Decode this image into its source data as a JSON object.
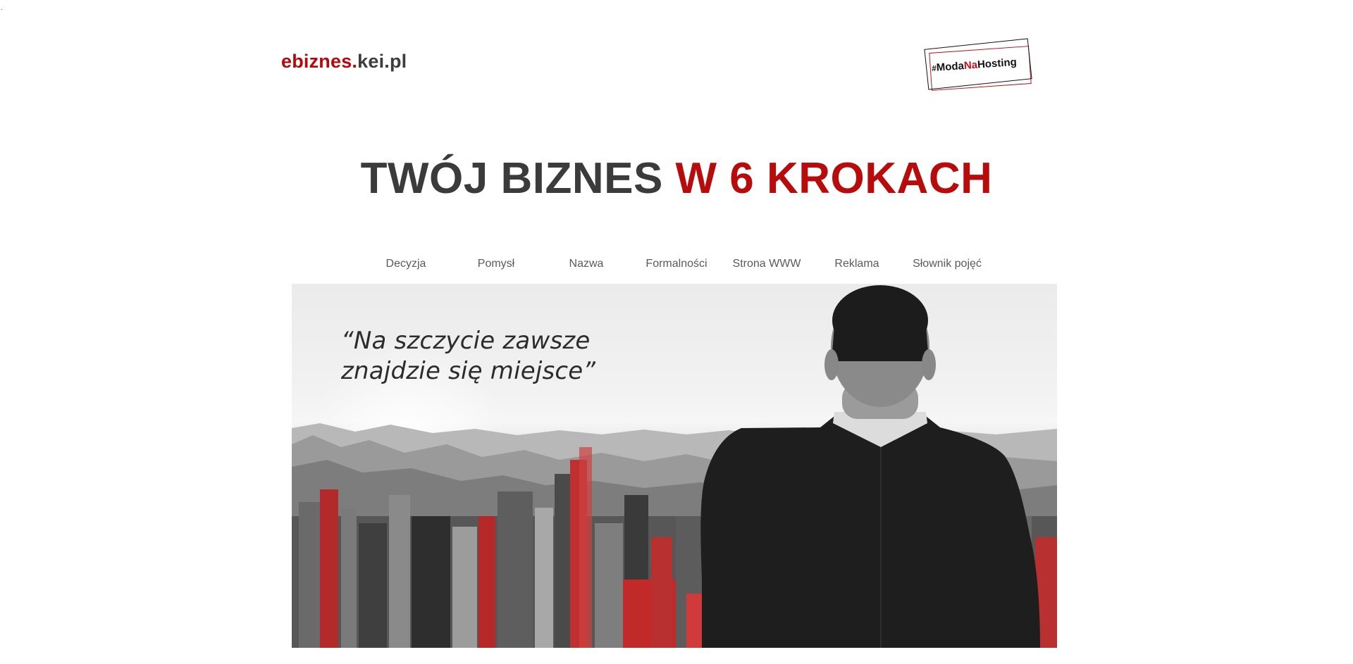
{
  "header": {
    "logo_part1": "ebiznes.",
    "logo_part2": "kei.pl",
    "badge_hash": "#",
    "badge_part1": "Moda",
    "badge_part2": "Na",
    "badge_part3": "Hosting"
  },
  "headline": {
    "part1": "TWÓJ BIZNES",
    "part2": "W 6 KROKACH"
  },
  "nav": {
    "items": [
      "Decyzja",
      "Pomysł",
      "Nazwa",
      "Formalności",
      "Strona WWW",
      "Reklama",
      "Słownik pojęć"
    ]
  },
  "hero": {
    "quote_line1": "“Na szczycie zawsze",
    "quote_line2": "znajdzie się miejsce”"
  },
  "colors": {
    "brand_red": "#b80b0b",
    "text_dark": "#3b3b3b"
  }
}
